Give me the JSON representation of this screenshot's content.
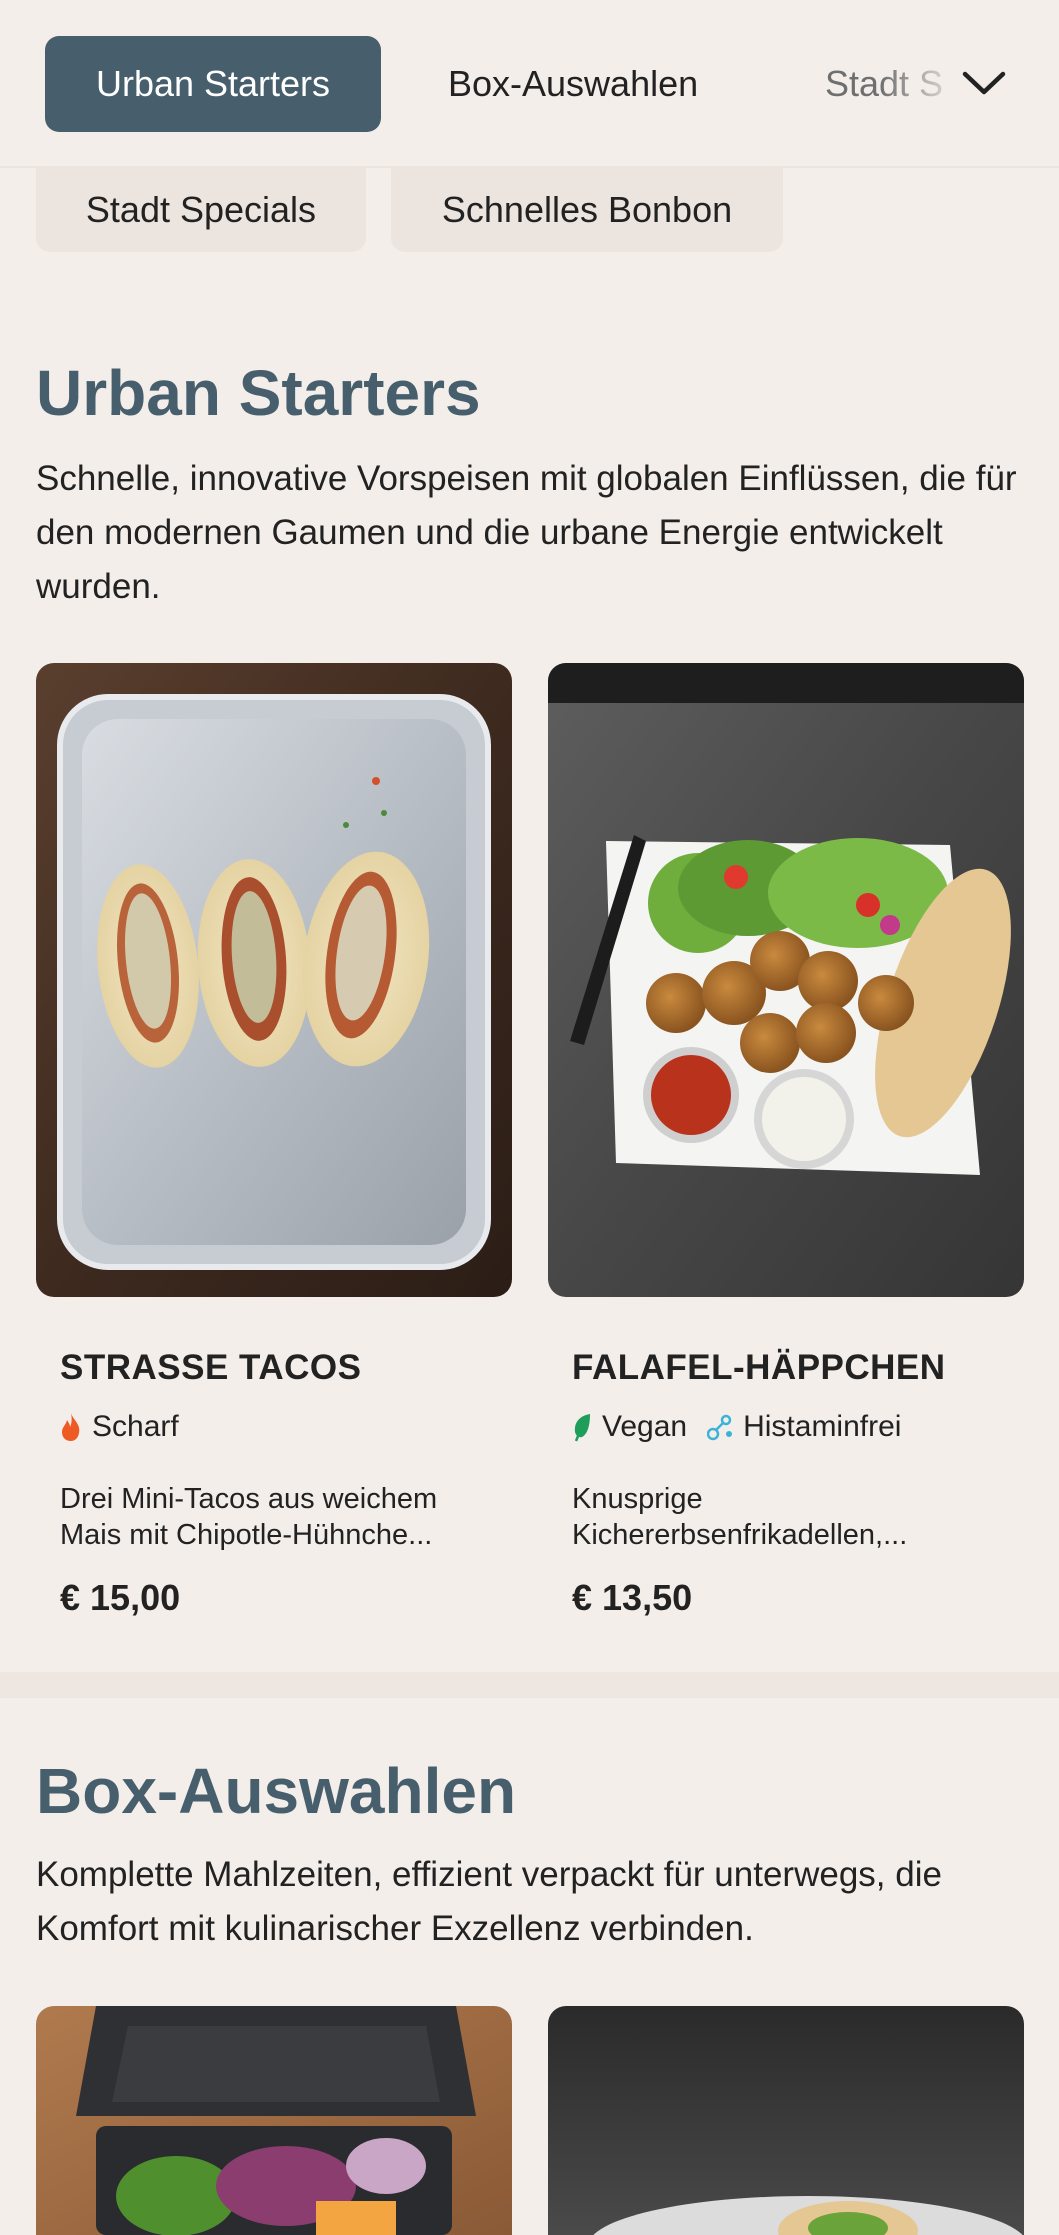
{
  "nav": {
    "tabs": [
      {
        "label": "Urban Starters",
        "active": true
      },
      {
        "label": "Box-Auswahlen",
        "active": false
      },
      {
        "label": "Stadt Specials",
        "active": false
      }
    ],
    "expand_icon": "chevron-down-icon",
    "pills": [
      "Stadt Specials",
      "Schnelles Bonbon"
    ]
  },
  "sections": [
    {
      "title": "Urban Starters",
      "description": "Schnelle, innovative Vorspeisen mit globalen Einflüssen, die für den modernen Gaumen und die urbane Energie entwickelt wurden.",
      "items": [
        {
          "name": "STRASSE TACOS",
          "tags": [
            {
              "icon": "flame-icon",
              "label": "Scharf",
              "color": "#ee5a24"
            }
          ],
          "description": "Drei Mini-Tacos aus weichem Mais mit Chipotle-Hühnche...",
          "price": "€ 15,00"
        },
        {
          "name": "FALAFEL-HÄPPCHEN",
          "tags": [
            {
              "icon": "leaf-icon",
              "label": "Vegan",
              "color": "#1e9e5a"
            },
            {
              "icon": "molecule-icon",
              "label": "Histaminfrei",
              "color": "#3bb3d6"
            }
          ],
          "description": "Knusprige Kichererbsenfrikadellen,...",
          "price": "€ 13,50"
        }
      ]
    },
    {
      "title": "Box-Auswahlen",
      "description": "Komplette Mahlzeiten, effizient verpackt für unterwegs, die Komfort mit kulinarischer Exzellenz verbinden."
    }
  ],
  "colors": {
    "accent": "#475f6c",
    "background": "#f4eeea"
  }
}
